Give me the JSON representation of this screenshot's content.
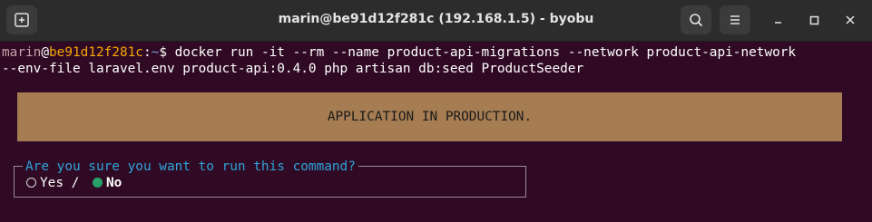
{
  "window": {
    "title": "marin@be91d12f281c (192.168.1.5) - byobu"
  },
  "prompt": {
    "user": "marin",
    "at": "@",
    "host": "be91d12f281c",
    "sep": ":",
    "path": "~",
    "symbol": "$"
  },
  "command": {
    "line1": " docker run -it --rm --name product-api-migrations --network product-api-network",
    "line2": "--env-file laravel.env product-api:0.4.0 php artisan db:seed ProductSeeder"
  },
  "banner": {
    "text": "APPLICATION IN PRODUCTION."
  },
  "confirm": {
    "question": "Are you sure you want to run this command?",
    "options": [
      "Yes",
      "No"
    ],
    "separator": " / ",
    "selected": "No"
  },
  "colors": {
    "background": "#300a24",
    "banner": "#a67c52",
    "question": "#2ea3d8",
    "selected": "#26a269",
    "host": "#f5a700"
  },
  "icons": {
    "new_tab": "new-tab-icon",
    "search": "search-icon",
    "menu": "hamburger-menu-icon",
    "minimize": "minimize-icon",
    "maximize": "maximize-icon",
    "close": "close-icon"
  }
}
